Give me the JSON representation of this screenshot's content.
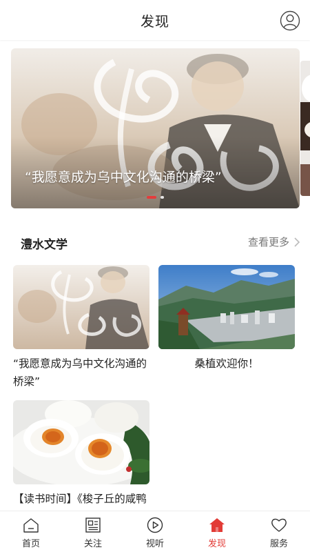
{
  "header": {
    "title": "发现",
    "profile_icon": "user-circle-icon"
  },
  "banner": {
    "caption": "“我愿意成为乌中文化沟通的桥梁”",
    "active_index": 0,
    "slide_count": 2
  },
  "section": {
    "title": "澧水文学",
    "more_label": "查看更多"
  },
  "cards": [
    {
      "title": "“我愿意成为乌中文化沟通的桥梁”"
    },
    {
      "title": "桑植欢迎你！"
    },
    {
      "title": "【读书时间】《梭子丘的咸鸭蛋》"
    }
  ],
  "tabs": [
    {
      "label": "首页",
      "icon": "home-icon"
    },
    {
      "label": "关注",
      "icon": "news-icon"
    },
    {
      "label": "视听",
      "icon": "play-icon"
    },
    {
      "label": "发现",
      "icon": "discover-house-icon"
    },
    {
      "label": "服务",
      "icon": "heart-icon"
    }
  ],
  "colors": {
    "accent": "#e23b36",
    "text": "#222222",
    "muted": "#777777"
  }
}
